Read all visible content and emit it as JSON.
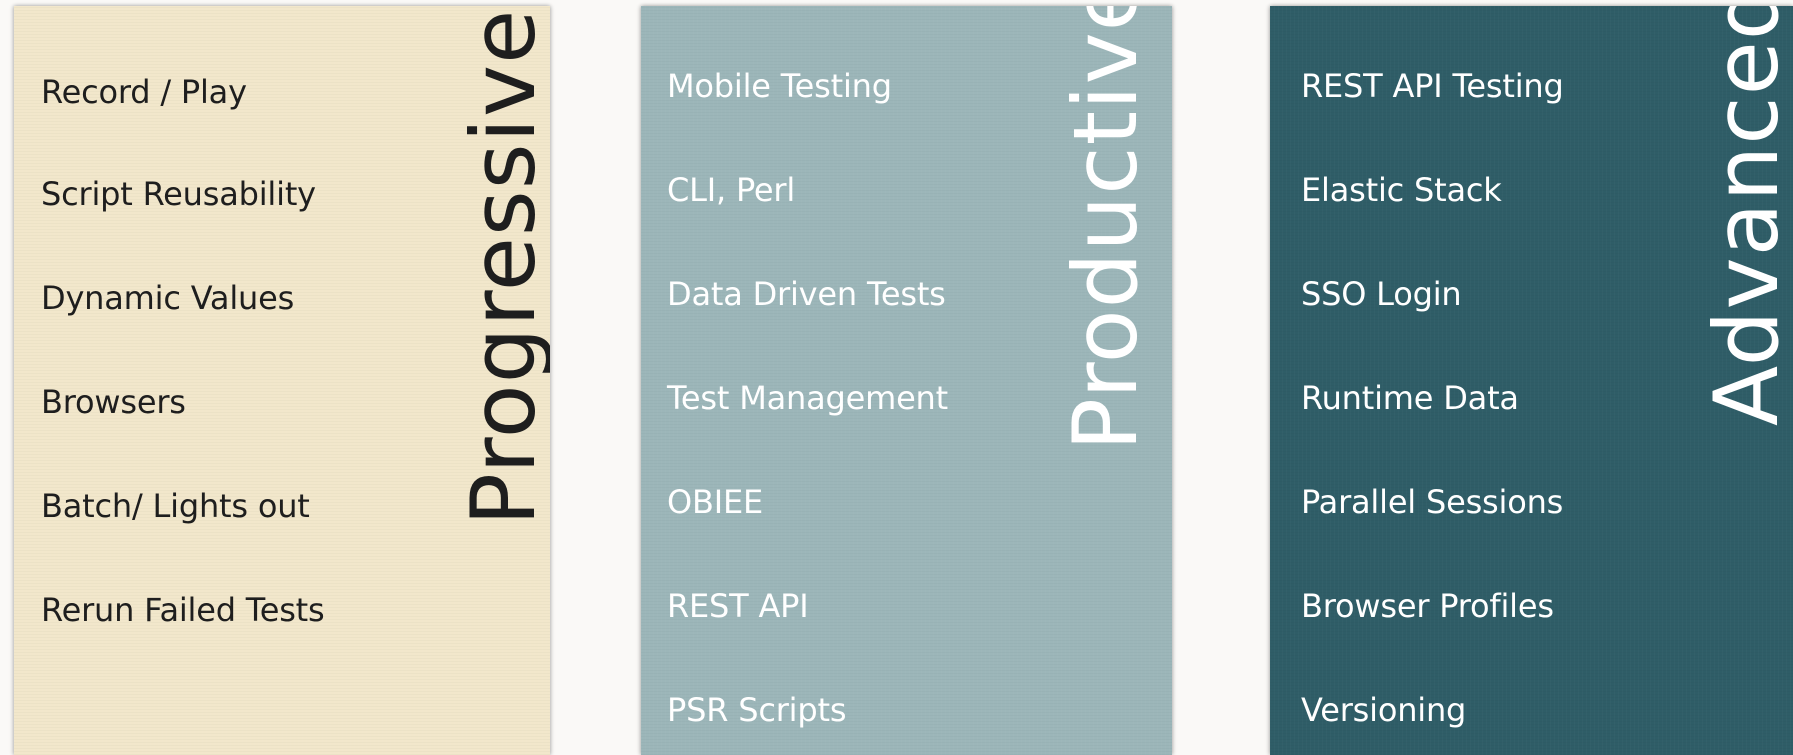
{
  "panels": [
    {
      "title": "Progressive",
      "background": "#f2e7cb",
      "text_color": "#1e1e1e",
      "items": [
        "Record / Play",
        "Script Reusability",
        "Dynamic Values",
        "Browsers",
        "Batch/ Lights out",
        "Rerun Failed Tests"
      ]
    },
    {
      "title": "Productive",
      "background": "#9cb6b9",
      "text_color": "#ffffff",
      "items": [
        "Mobile Testing",
        "CLI, Perl",
        "Data Driven Tests",
        "Test Management",
        "OBIEE",
        "REST API",
        "PSR Scripts"
      ]
    },
    {
      "title": "Advanced",
      "background": "#2f5d67",
      "text_color": "#ffffff",
      "items": [
        "REST API Testing",
        "Elastic Stack",
        "SSO Login",
        "Runtime Data",
        "Parallel Sessions",
        "Browser Profiles",
        "Versioning"
      ]
    }
  ]
}
